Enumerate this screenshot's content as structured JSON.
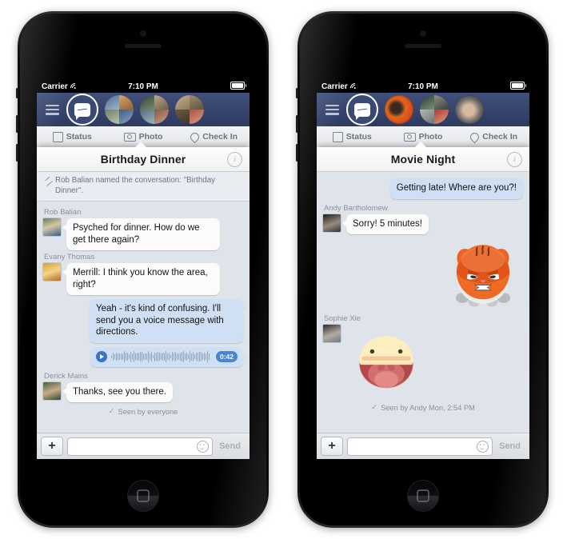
{
  "phones": [
    {
      "id": "phone-1",
      "statusbar": {
        "carrier": "Carrier",
        "time": "7:10 PM",
        "wifi_icon": "wifi-icon",
        "battery_icon": "battery-icon"
      },
      "fb_nav": {
        "menu_icon": "hamburger-menu-icon",
        "messenger_icon": "messenger-bubble-icon",
        "chatheads": [
          "chathead-avatar-1",
          "chathead-avatar-2",
          "chathead-avatar-3"
        ]
      },
      "fb_composer": [
        {
          "label": "Status",
          "icon": "status-compose-icon"
        },
        {
          "label": "Photo",
          "icon": "camera-icon"
        },
        {
          "label": "Check In",
          "icon": "location-pin-icon"
        }
      ],
      "sheet": {
        "title": "Birthday Dinner",
        "info_icon": "info-icon",
        "system_message": "Rob Balian named the conversation: \"Birthday Dinner\".",
        "system_icon": "pencil-icon",
        "messages": [
          {
            "kind": "text",
            "direction": "in",
            "sender": "Rob Balian",
            "text": "Psyched for dinner. How do we get there again?",
            "avatar": "avatar-rob-balian"
          },
          {
            "kind": "text",
            "direction": "in",
            "sender": "Evany Thomas",
            "text": "Merrill: I think you know the area, right?",
            "avatar": "avatar-evany-thomas"
          },
          {
            "kind": "text",
            "direction": "out",
            "sender": "",
            "text": "Yeah - it's kind of confusing. I'll send you a voice message with directions."
          },
          {
            "kind": "voice",
            "direction": "out",
            "duration": "0:42",
            "play_icon": "play-icon"
          },
          {
            "kind": "text",
            "direction": "in",
            "sender": "Derick Mains",
            "text": "Thanks, see you there.",
            "avatar": "avatar-derick-mains"
          }
        ],
        "receipt": "Seen by everyone",
        "receipt_icon": "checkmark-icon"
      },
      "input": {
        "add_label": "+",
        "placeholder": "",
        "value": "",
        "emoji_icon": "smiley-icon",
        "send_label": "Send"
      }
    },
    {
      "id": "phone-2",
      "statusbar": {
        "carrier": "Carrier",
        "time": "7:10 PM",
        "wifi_icon": "wifi-icon",
        "battery_icon": "battery-icon"
      },
      "fb_nav": {
        "menu_icon": "hamburger-menu-icon",
        "messenger_icon": "messenger-bubble-icon",
        "chatheads": [
          "chathead-avatar-1",
          "chathead-avatar-2",
          "chathead-avatar-3"
        ]
      },
      "fb_composer": [
        {
          "label": "Status",
          "icon": "status-compose-icon"
        },
        {
          "label": "Photo",
          "icon": "camera-icon"
        },
        {
          "label": "Check In",
          "icon": "location-pin-icon"
        }
      ],
      "sheet": {
        "title": "Movie Night",
        "info_icon": "info-icon",
        "system_message": "",
        "messages": [
          {
            "kind": "text",
            "direction": "out",
            "sender": "",
            "text": "Getting late! Where are you?!"
          },
          {
            "kind": "text",
            "direction": "in",
            "sender": "Andy Bartholomew",
            "text": "Sorry! 5 minutes!",
            "avatar": "avatar-andy-bartholomew"
          },
          {
            "kind": "sticker",
            "direction": "out",
            "sticker": "angry-cat-sticker"
          },
          {
            "kind": "sticker",
            "direction": "in",
            "sender": "Sophie Xie",
            "sticker": "open-mouth-sticker",
            "avatar": "avatar-sophie-xie"
          }
        ],
        "receipt": "Seen by Andy Mon, 2:54 PM",
        "receipt_icon": "checkmark-icon"
      },
      "input": {
        "add_label": "+",
        "placeholder": "",
        "value": "",
        "emoji_icon": "smiley-icon",
        "send_label": "Send"
      }
    }
  ],
  "colors": {
    "outgoing_bubble": "#cfe0f5",
    "incoming_bubble": "#fbfbfc",
    "thread_background": "#dfe3ea",
    "fb_navbar": "#2d3a60",
    "accent_blue": "#3b73c4"
  }
}
